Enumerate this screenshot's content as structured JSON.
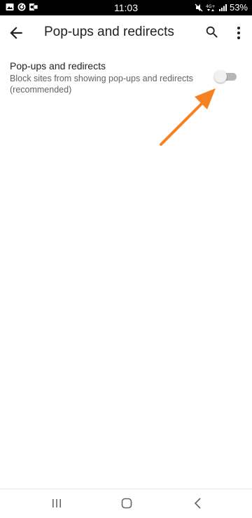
{
  "status_bar": {
    "time": "11:03",
    "battery_label": "53%",
    "left_icons": [
      "gallery-icon",
      "sync-icon",
      "outlook-icon"
    ],
    "right_icons": [
      "mute-icon",
      "signal-4g-icon",
      "cellular-signal-icon"
    ]
  },
  "app_bar": {
    "title": "Pop-ups and redirects",
    "icons": [
      "back-arrow-icon",
      "search-icon",
      "more-vert-icon"
    ]
  },
  "setting": {
    "title": "Pop-ups and redirects",
    "description": "Block sites from showing pop-ups and redirects (recommended)",
    "toggle_on": false
  },
  "annotation": {
    "arrow_color": "#f58220"
  },
  "nav_bar": {
    "icons": [
      "recents-icon",
      "home-icon",
      "back-icon"
    ]
  },
  "colors": {
    "status_bar_bg": "#000000",
    "text_primary": "#202124",
    "text_secondary": "#5f6368",
    "toggle_off_track": "#b6b6b6",
    "toggle_off_thumb": "#f1f1f1"
  }
}
